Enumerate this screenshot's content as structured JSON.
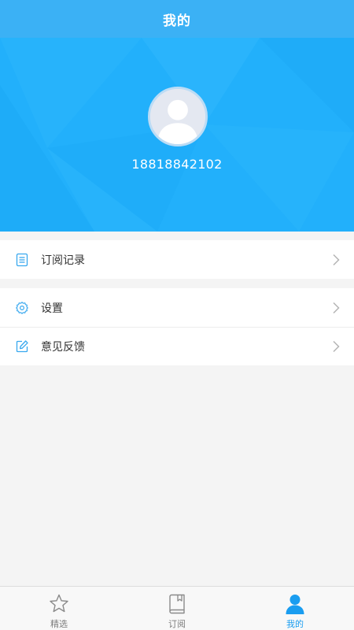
{
  "navbar": {
    "title": "我的"
  },
  "profile": {
    "phone": "18818842102"
  },
  "menu_group_1": [
    {
      "label": "订阅记录",
      "icon": "list-document-icon"
    }
  ],
  "menu_group_2": [
    {
      "label": "设置",
      "icon": "gear-icon"
    },
    {
      "label": "意见反馈",
      "icon": "edit-icon"
    }
  ],
  "tabbar": {
    "tabs": [
      {
        "label": "精选",
        "icon": "star-icon",
        "active": false
      },
      {
        "label": "订阅",
        "icon": "book-icon",
        "active": false
      },
      {
        "label": "我的",
        "icon": "person-icon",
        "active": true
      }
    ]
  },
  "colors": {
    "accent": "#22b0fb",
    "navbar": "#3bb1f5",
    "active_tab": "#1a9df0",
    "inactive_tab": "#7d7d7d"
  }
}
